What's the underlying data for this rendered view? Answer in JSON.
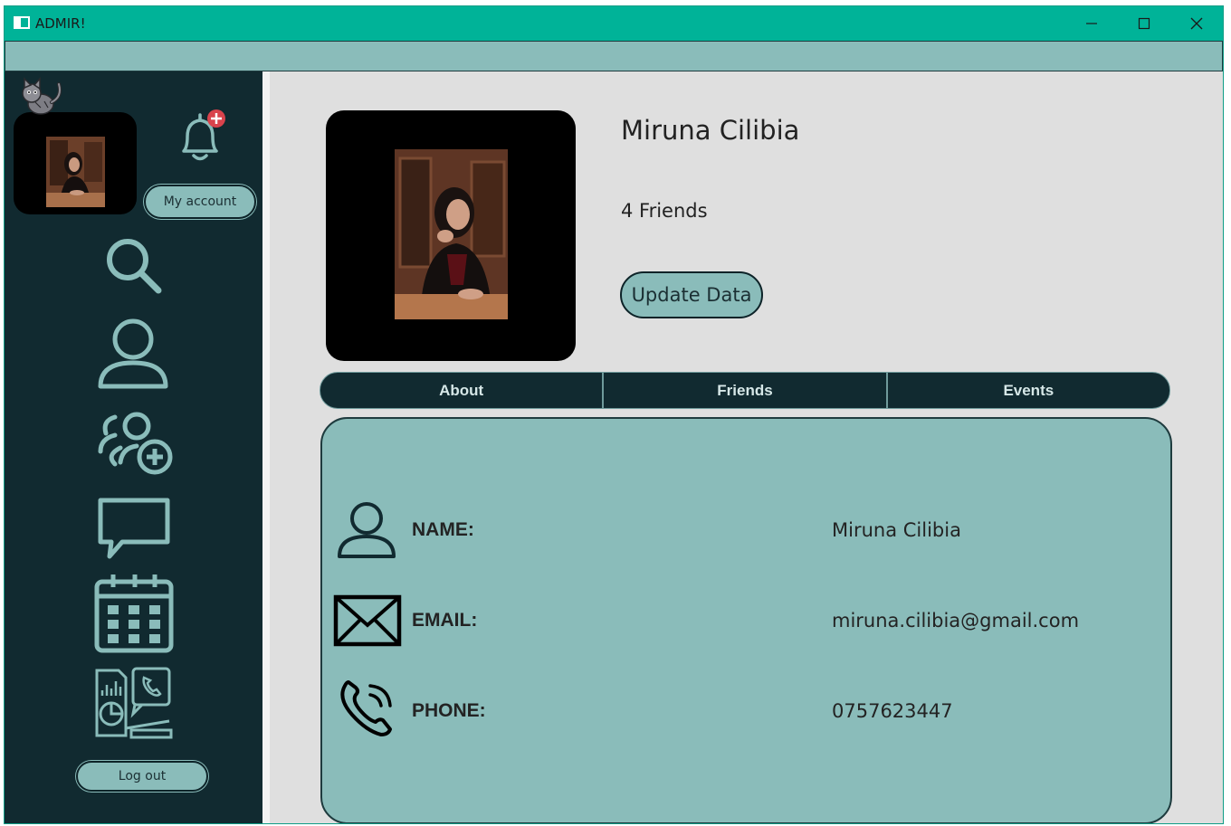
{
  "window": {
    "title": "ADMIR!"
  },
  "sidebar": {
    "my_account_label": "My account",
    "logout_label": "Log out",
    "icons": [
      "cat-mascot-icon",
      "bell-notification-icon",
      "search-icon",
      "profile-icon",
      "add-group-icon",
      "chat-icon",
      "calendar-icon",
      "report-icon"
    ]
  },
  "profile": {
    "name": "Miruna Cilibia",
    "friends": "4 Friends",
    "update_label": "Update Data"
  },
  "tabs": [
    {
      "label": "About"
    },
    {
      "label": "Friends"
    },
    {
      "label": "Events"
    }
  ],
  "about": {
    "rows": [
      {
        "icon": "person-icon",
        "label": "NAME:",
        "value": "Miruna Cilibia"
      },
      {
        "icon": "envelope-icon",
        "label": "EMAIL:",
        "value": "miruna.cilibia@gmail.com"
      },
      {
        "icon": "phone-icon",
        "label": "PHONE:",
        "value": "0757623447"
      }
    ]
  },
  "colors": {
    "titlebar": "#00b398",
    "sidebar": "#112a30",
    "accent": "#8abcba",
    "content_bg": "#dfdfdf",
    "icon_stroke": "#8abcba",
    "notification_badge": "#d9434c"
  }
}
